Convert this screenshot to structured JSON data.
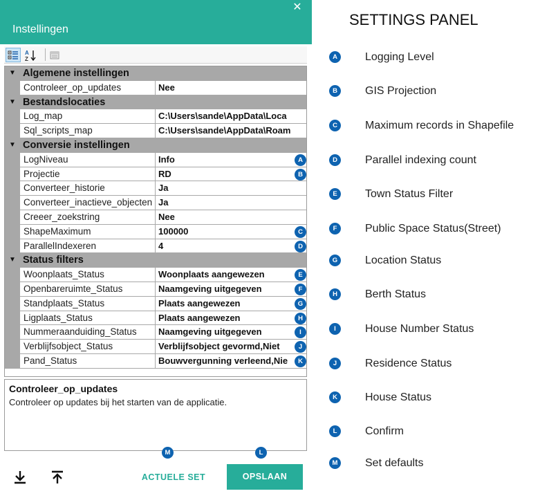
{
  "window": {
    "title": "Instellingen",
    "close_icon": "close-icon",
    "accent_color": "#27ad9a"
  },
  "toolbar": {
    "buttons": [
      {
        "icon": "categorized-view-icon",
        "active": true
      },
      {
        "icon": "alphabetical-sort-icon",
        "active": false
      },
      {
        "icon": "property-pages-icon",
        "active": false
      }
    ]
  },
  "grid": {
    "categories": [
      {
        "label": "Algemene instellingen",
        "expanded": true,
        "properties": [
          {
            "name": "Controleer_op_updates",
            "value": "Nee",
            "marker": ""
          }
        ]
      },
      {
        "label": "Bestandslocaties",
        "expanded": true,
        "properties": [
          {
            "name": "Log_map",
            "value": "C:\\Users\\sande\\AppData\\Loca",
            "marker": ""
          },
          {
            "name": "Sql_scripts_map",
            "value": "C:\\Users\\sande\\AppData\\Roam",
            "marker": ""
          }
        ]
      },
      {
        "label": "Conversie instellingen",
        "expanded": true,
        "properties": [
          {
            "name": "LogNiveau",
            "value": "Info",
            "marker": "A"
          },
          {
            "name": "Projectie",
            "value": "RD",
            "marker": "B"
          },
          {
            "name": "Converteer_historie",
            "value": "Ja",
            "marker": ""
          },
          {
            "name": "Converteer_inactieve_objecten",
            "value": "Ja",
            "marker": ""
          },
          {
            "name": "Creeer_zoekstring",
            "value": "Nee",
            "marker": ""
          },
          {
            "name": "ShapeMaximum",
            "value": "100000",
            "marker": "C"
          },
          {
            "name": "ParallelIndexeren",
            "value": "4",
            "marker": "D"
          }
        ]
      },
      {
        "label": "Status filters",
        "expanded": true,
        "properties": [
          {
            "name": "Woonplaats_Status",
            "value": "Woonplaats aangewezen",
            "marker": "E"
          },
          {
            "name": "Openbareruimte_Status",
            "value": "Naamgeving uitgegeven",
            "marker": "F"
          },
          {
            "name": "Standplaats_Status",
            "value": "Plaats aangewezen",
            "marker": "G"
          },
          {
            "name": "Ligplaats_Status",
            "value": "Plaats aangewezen",
            "marker": "H"
          },
          {
            "name": "Nummeraanduiding_Status",
            "value": "Naamgeving uitgegeven",
            "marker": "I"
          },
          {
            "name": "Verblijfsobject_Status",
            "value": "Verblijfsobject gevormd,Niet",
            "marker": "J"
          },
          {
            "name": "Pand_Status",
            "value": "Bouwvergunning verleend,Nie",
            "marker": "K"
          }
        ]
      }
    ]
  },
  "description": {
    "title": "Controleer_op_updates",
    "text": "Controleer op updates bij het starten van de applicatie."
  },
  "footer": {
    "import_icon": "download-icon",
    "export_icon": "upload-icon",
    "defaults_label": "ACTUELE SET",
    "defaults_marker": "M",
    "save_label": "OPSLAAN",
    "save_marker": "L"
  },
  "legend": {
    "title": "SETTINGS PANEL",
    "items": [
      {
        "marker": "A",
        "text": "Logging Level"
      },
      {
        "marker": "B",
        "text": "GIS Projection"
      },
      {
        "marker": "C",
        "text": "Maximum records in Shapefile"
      },
      {
        "marker": "D",
        "text": "Parallel indexing count"
      },
      {
        "marker": "E",
        "text": "Town Status Filter"
      },
      {
        "marker": "F",
        "text": "Public Space Status(Street)"
      },
      {
        "marker": "G",
        "text": "Location Status"
      },
      {
        "marker": "H",
        "text": "Berth Status"
      },
      {
        "marker": "I",
        "text": "House Number Status"
      },
      {
        "marker": "J",
        "text": "Residence Status"
      },
      {
        "marker": "K",
        "text": "House Status"
      },
      {
        "marker": "L",
        "text": "Confirm"
      },
      {
        "marker": "M",
        "text": "Set defaults"
      }
    ]
  }
}
